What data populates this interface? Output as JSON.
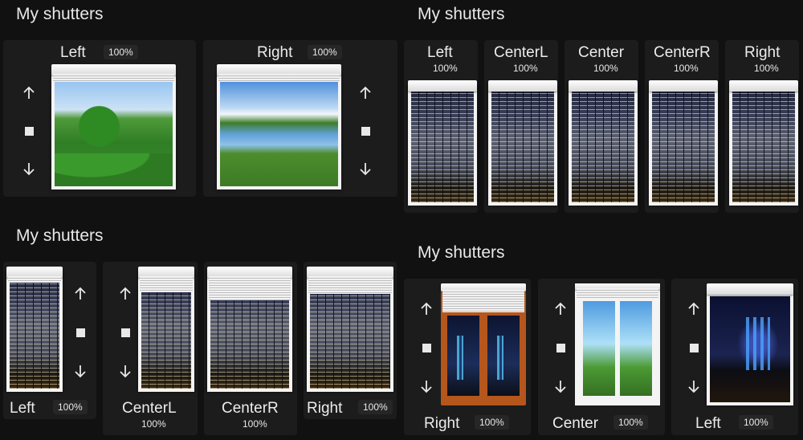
{
  "cards": [
    {
      "title": "My shutters",
      "items": [
        {
          "label": "Left",
          "position": "100%"
        },
        {
          "label": "Right",
          "position": "100%"
        }
      ]
    },
    {
      "title": "My shutters",
      "items": [
        {
          "label": "Left",
          "position": "100%"
        },
        {
          "label": "CenterL",
          "position": "100%"
        },
        {
          "label": "Center",
          "position": "100%"
        },
        {
          "label": "CenterR",
          "position": "100%"
        },
        {
          "label": "Right",
          "position": "100%"
        }
      ]
    },
    {
      "title": "My shutters",
      "items": [
        {
          "label": "Left",
          "position": "100%"
        },
        {
          "label": "CenterL",
          "position": "100%"
        },
        {
          "label": "CenterR",
          "position": "100%"
        },
        {
          "label": "Right",
          "position": "100%"
        }
      ]
    },
    {
      "title": "My shutters",
      "items": [
        {
          "label": "Right",
          "position": "100%"
        },
        {
          "label": "Center",
          "position": "100%"
        },
        {
          "label": "Left",
          "position": "100%"
        }
      ]
    }
  ],
  "icons": {
    "up": "arrow-up-icon",
    "stop": "stop-icon",
    "down": "arrow-down-icon"
  },
  "colors": {
    "background": "#111111",
    "card": "#1c1c1c",
    "text": "#e6e6e6"
  }
}
